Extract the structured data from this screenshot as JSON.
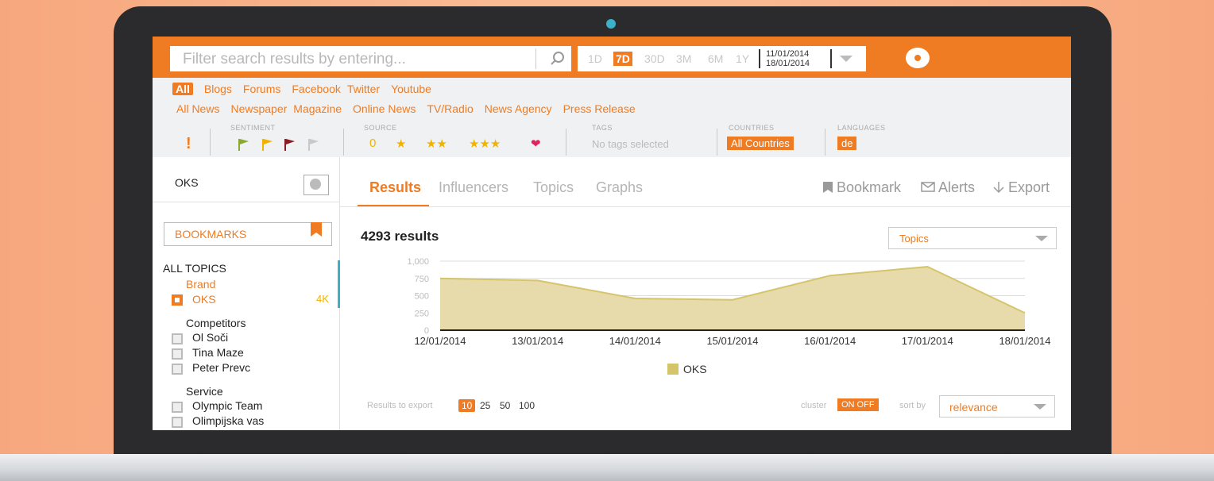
{
  "search": {
    "placeholder": "Filter search results by entering..."
  },
  "ranges": [
    "1D",
    "7D",
    "30D",
    "3M",
    "6M",
    "1Y"
  ],
  "active_range": "7D",
  "dates": {
    "from": "11/01/2014",
    "to": "18/01/2014"
  },
  "channels": [
    "All",
    "Blogs",
    "Forums",
    "Facebook",
    "Twitter",
    "Youtube"
  ],
  "news_types": [
    "All News",
    "Newspaper",
    "Magazine",
    "Online News",
    "TV/Radio",
    "News Agency",
    "Press Release"
  ],
  "filters": {
    "sentiment_label": "SENTIMENT",
    "alert_mark": "!",
    "source_label": "SOURCE",
    "source_items": [
      "0",
      "★",
      "★★",
      "★★★",
      "❤"
    ],
    "tags_label": "TAGS",
    "tags_value": "No tags selected",
    "countries_label": "COUNTRIES",
    "countries_value": "All Countries",
    "languages_label": "LANGUAGES",
    "languages_value": "de"
  },
  "sidebar": {
    "query": "OKS",
    "bookmarks_label": "BOOKMARKS",
    "all_topics": "ALL TOPICS",
    "brand_heading": "Brand",
    "brand_item": "OKS",
    "brand_count": "4K",
    "competitors_heading": "Competitors",
    "competitors": [
      "Ol Soči",
      "Tina Maze",
      "Peter Prevc"
    ],
    "service_heading": "Service",
    "service": [
      "Olympic Team",
      "Olimpijska vas"
    ]
  },
  "tabs": [
    "Results",
    "Influencers",
    "Topics",
    "Graphs"
  ],
  "actions": {
    "bookmark": "Bookmark",
    "alerts": "Alerts",
    "export": "Export"
  },
  "results_count": "4293 results",
  "topics_select": "Topics",
  "bottom": {
    "export_label": "Results to export",
    "export_options": [
      "10",
      "25",
      "50",
      "100"
    ],
    "cluster_label": "cluster",
    "cluster_toggle": "ON OFF",
    "sort_label": "sort by",
    "sort_value": "relevance"
  },
  "colors": {
    "accent": "#ef7c22",
    "series": "#d6c46b"
  },
  "chart_data": {
    "type": "area",
    "x": [
      "12/01/2014",
      "13/01/2014",
      "14/01/2014",
      "15/01/2014",
      "16/01/2014",
      "17/01/2014",
      "18/01/2014"
    ],
    "y_ticks": [
      "0",
      "250",
      "500",
      "750",
      "1,000"
    ],
    "ylim": [
      0,
      1000
    ],
    "series": [
      {
        "name": "OKS",
        "values": [
          750,
          720,
          460,
          440,
          790,
          920,
          250
        ]
      }
    ],
    "legend": "bottom",
    "grid": true
  }
}
